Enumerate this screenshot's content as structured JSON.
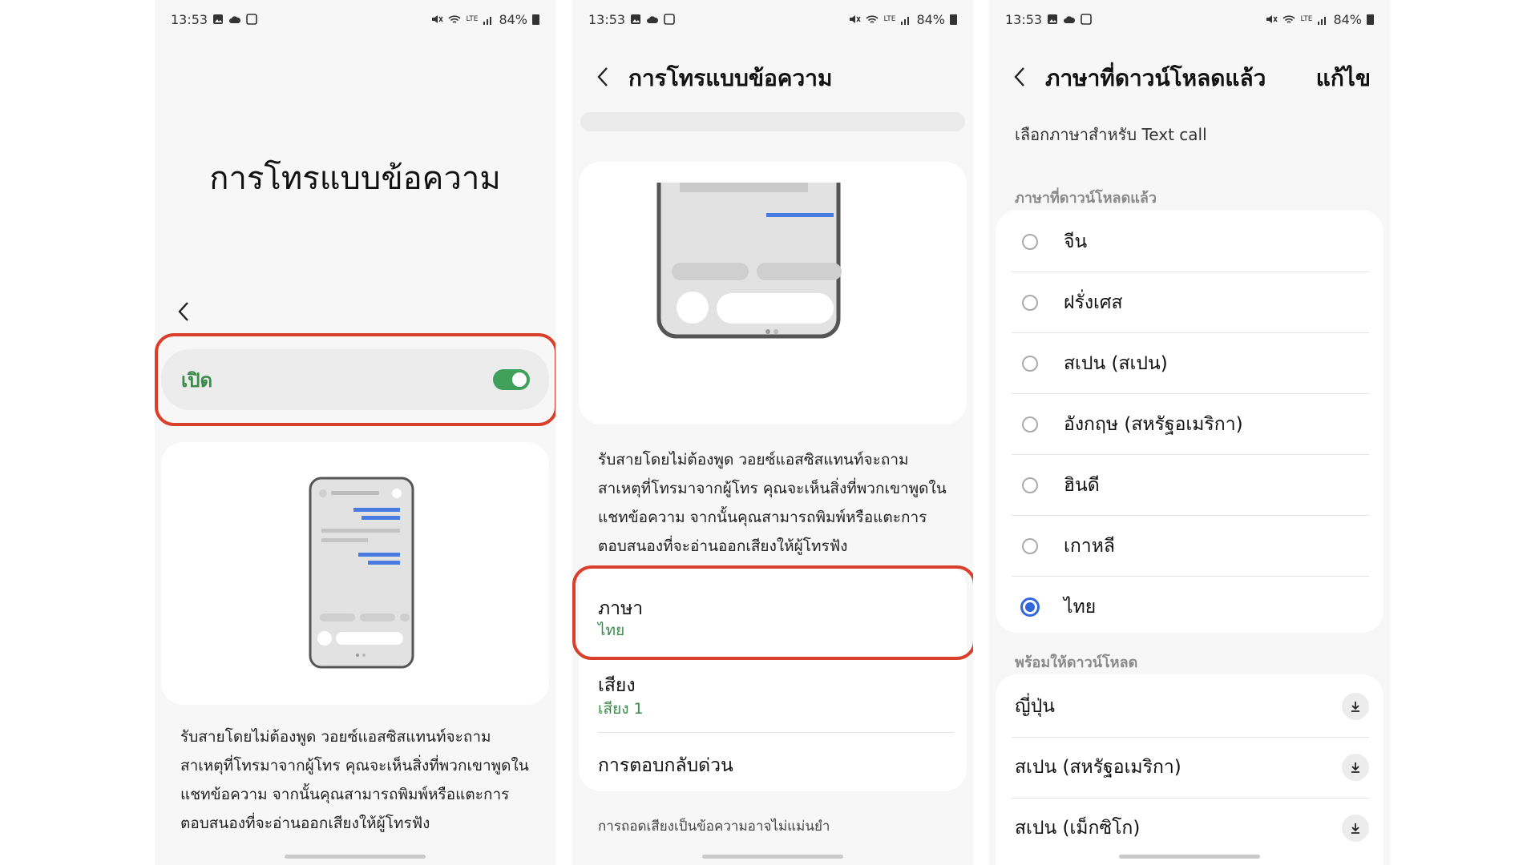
{
  "status": {
    "time": "13:53",
    "battery": "84%",
    "net": "LTE"
  },
  "screen1": {
    "title": "การโทรแบบข้อความ",
    "toggle_label": "เปิด",
    "toggle_on": true,
    "description": "รับสายโดยไม่ต้องพูด วอยซ์แอสซิสแทนท์จะถามสาเหตุที่โทรมาจากผู้โทร คุณจะเห็นสิ่งที่พวกเขาพูดในแชทข้อความ จากนั้นคุณสามารถพิมพ์หรือแตะการตอบสนองที่จะอ่านออกเสียงให้ผู้โทรฟัง"
  },
  "screen2": {
    "title": "การโทรแบบข้อความ",
    "description": "รับสายโดยไม่ต้องพูด วอยซ์แอสซิสแทนท์จะถามสาเหตุที่โทรมาจากผู้โทร คุณจะเห็นสิ่งที่พวกเขาพูดในแชทข้อความ จากนั้นคุณสามารถพิมพ์หรือแตะการตอบสนองที่จะอ่านออกเสียงให้ผู้โทรฟัง",
    "language": {
      "label": "ภาษา",
      "value": "ไทย"
    },
    "voice": {
      "label": "เสียง",
      "value": "เสียง 1"
    },
    "quick_reply": "การตอบกลับด่วน",
    "footnote": "การถอดเสียงเป็นข้อความอาจไม่แม่นยำ"
  },
  "screen3": {
    "title": "ภาษาที่ดาวน์โหลดแล้ว",
    "edit": "แก้ไข",
    "subtitle": "เลือกภาษาสำหรับ Text call",
    "downloaded_header": "ภาษาที่ดาวน์โหลดแล้ว",
    "downloaded": [
      {
        "label": "จีน",
        "selected": false
      },
      {
        "label": "ฝรั่งเศส",
        "selected": false
      },
      {
        "label": "สเปน (สเปน)",
        "selected": false
      },
      {
        "label": "อังกฤษ (สหรัฐอเมริกา)",
        "selected": false
      },
      {
        "label": "ฮินดี",
        "selected": false
      },
      {
        "label": "เกาหลี",
        "selected": false
      },
      {
        "label": "ไทย",
        "selected": true
      }
    ],
    "available_header": "พร้อมให้ดาวน์โหลด",
    "available": [
      {
        "label": "ญี่ปุ่น"
      },
      {
        "label": "สเปน (สหรัฐอเมริกา)"
      },
      {
        "label": "สเปน (เม็กซิโก)"
      }
    ]
  },
  "colors": {
    "accent_green": "#3a8a4a",
    "switch_green": "#3fa05a",
    "radio_blue": "#3366dd",
    "highlight_red": "#d9402b"
  }
}
